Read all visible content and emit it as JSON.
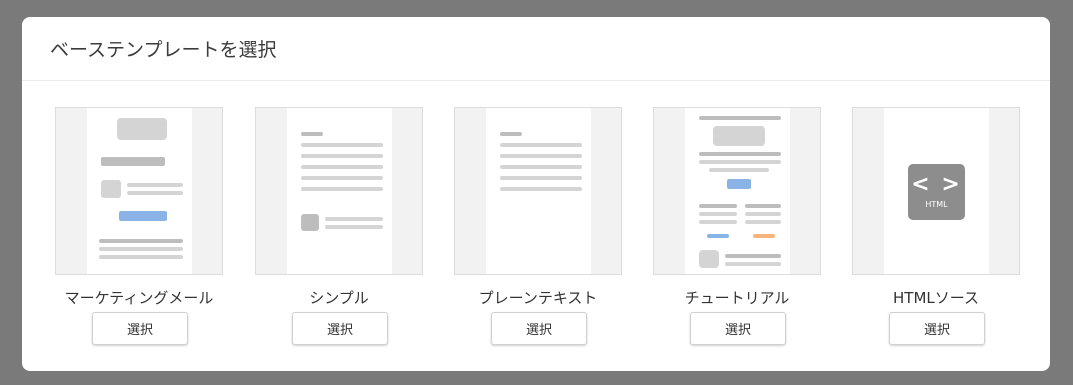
{
  "modal": {
    "title": "ベーステンプレートを選択"
  },
  "templates": [
    {
      "label": "マーケティングメール",
      "button": "選択"
    },
    {
      "label": "シンプル",
      "button": "選択"
    },
    {
      "label": "プレーンテキスト",
      "button": "選択"
    },
    {
      "label": "チュートリアル",
      "button": "選択"
    },
    {
      "label": "HTMLソース",
      "button": "選択",
      "badge_code": "< >",
      "badge_tag": "HTML"
    }
  ],
  "colors": {
    "accent_blue": "#8ab4e8",
    "accent_orange": "#f5b47a",
    "overlay": "#7a7a7a"
  }
}
